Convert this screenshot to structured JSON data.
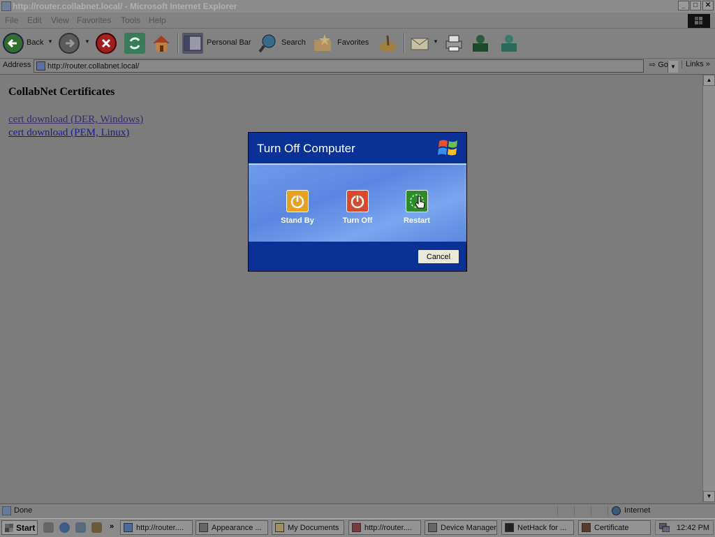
{
  "window": {
    "title": "http://router.collabnet.local/ - Microsoft Internet Explorer",
    "controls": [
      "_",
      "□",
      "✕"
    ]
  },
  "menu": [
    "File",
    "Edit",
    "View",
    "Favorites",
    "Tools",
    "Help"
  ],
  "toolbar": {
    "back_label": "Back",
    "personal_bar_label": "Personal Bar",
    "search_label": "Search",
    "favorites_label": "Favorites"
  },
  "address": {
    "label": "Address",
    "url": "http://router.collabnet.local/",
    "go_label": "Go",
    "links_label": "Links"
  },
  "page": {
    "heading": "CollabNet Certificates",
    "links": [
      "cert download (DER, Windows)",
      "cert download (PEM, Linux)"
    ]
  },
  "status": {
    "text": "Done",
    "zone": "Internet"
  },
  "taskbar": {
    "start_label": "Start",
    "tasks": [
      "http://router....",
      "Appearance ...",
      "My Documents",
      "http://router....",
      "Device Manager",
      "NetHack for ...",
      "Certificate"
    ],
    "clock": "12:42 PM",
    "overflow": "»"
  },
  "dialog": {
    "title": "Turn Off Computer",
    "options": [
      "Stand By",
      "Turn Off",
      "Restart"
    ],
    "cancel_label": "Cancel",
    "colors": {
      "stand_by": "#e8a020",
      "turn_off": "#d84a2e",
      "restart": "#2e8a2a"
    }
  }
}
